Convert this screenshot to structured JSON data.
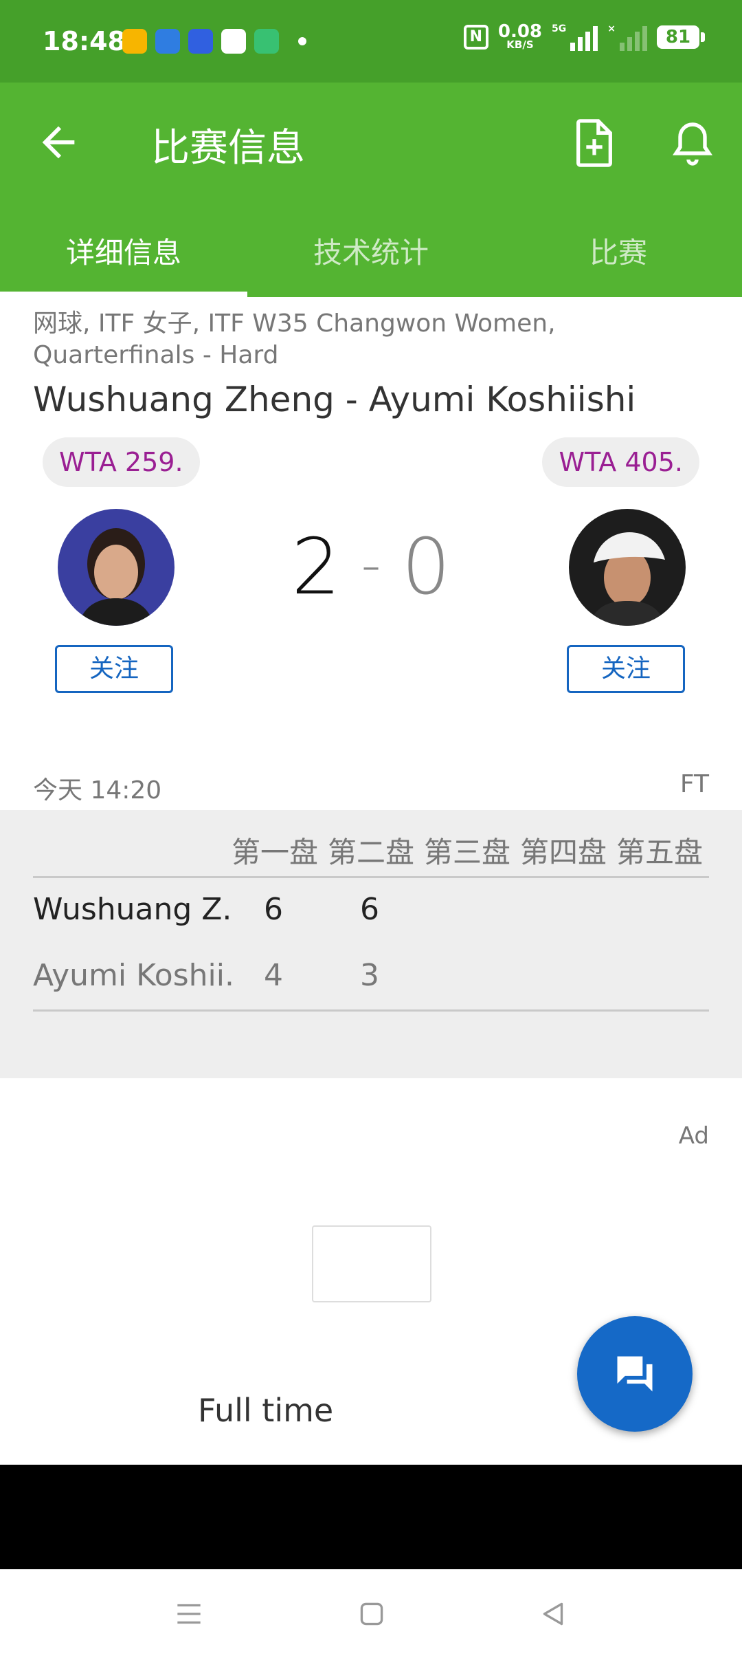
{
  "status_bar": {
    "time": "18:48",
    "net_speed": "0.08",
    "net_unit": "KB/S",
    "sim1_label": "5G",
    "sim2_label": "×",
    "battery": "81",
    "nfc": "N"
  },
  "app_bar": {
    "title": "比赛信息"
  },
  "tabs": [
    {
      "label": "详细信息",
      "active": true
    },
    {
      "label": "技术统计",
      "active": false
    },
    {
      "label": "比赛",
      "active": false
    }
  ],
  "match": {
    "competition": "网球, ITF 女子, ITF W35 Changwon Women, Quarterfinals - Hard",
    "title": "Wushuang Zheng - Ayumi Koshiishi",
    "home": {
      "rank": "WTA 259.",
      "follow_label": "关注",
      "score": "2"
    },
    "away": {
      "rank": "WTA 405.",
      "follow_label": "关注",
      "score": "0"
    },
    "score_separator": "-",
    "date": "今天 14:20",
    "status": "FT"
  },
  "sets": {
    "headers": [
      "第一盘",
      "第二盘",
      "第三盘",
      "第四盘",
      "第五盘"
    ],
    "rows": [
      {
        "name": "Wushuang Z...",
        "s1": "6",
        "s2": "6"
      },
      {
        "name": "Ayumi Koshii...",
        "s1": "4",
        "s2": "3"
      }
    ]
  },
  "ad": {
    "label": "Ad"
  },
  "event_text": "Full time",
  "colors": {
    "status_bar": "#45a02a",
    "app_bar": "#54b432",
    "rank_text": "#9a1f93",
    "follow": "#1565c0",
    "fab": "#1569c7"
  }
}
